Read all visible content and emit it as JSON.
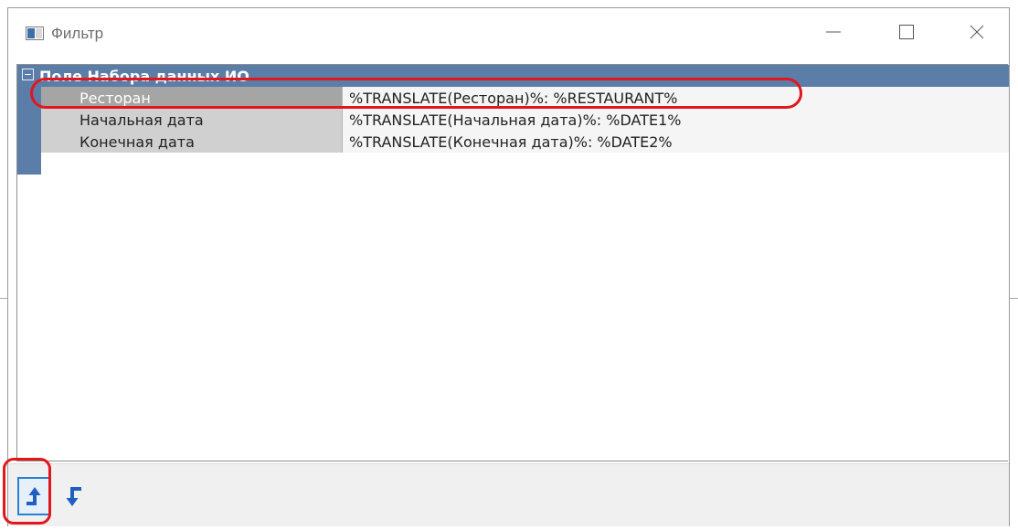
{
  "window": {
    "title": "Фильтр",
    "icons": {
      "app": "app-window-icon",
      "minimize": "minimize-icon",
      "maximize": "maximize-icon",
      "close": "close-icon"
    }
  },
  "property_grid": {
    "category": {
      "label": "Поле Набора данных ИО",
      "expanded": true,
      "icon": "collapse-minus-icon"
    },
    "rows": [
      {
        "name": "Ресторан",
        "value": "%TRANSLATE(Ресторан)%: %RESTAURANT%",
        "selected": true
      },
      {
        "name": "Начальная дата",
        "value": "%TRANSLATE(Начальная дата)%: %DATE1%",
        "selected": false
      },
      {
        "name": "Конечная дата",
        "value": "%TRANSLATE(Конечная дата)%: %DATE2%",
        "selected": false
      }
    ]
  },
  "toolbar": {
    "buttons": [
      {
        "icon": "arrow-turn-up-icon",
        "active": true
      },
      {
        "icon": "arrow-turn-back-icon",
        "active": false
      }
    ]
  },
  "colors": {
    "category_bg": "#5b7ea9",
    "selected_row_bg": "#a5a5a5",
    "annotation": "#e3161b",
    "button_icon": "#1e5fc4"
  }
}
